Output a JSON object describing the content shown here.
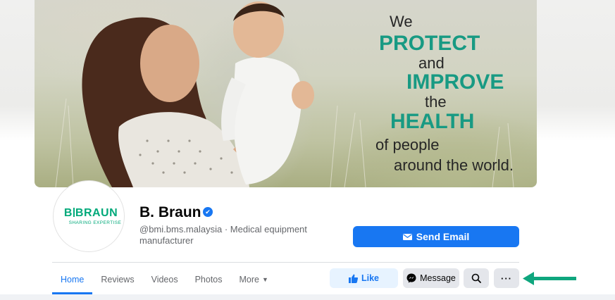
{
  "cover": {
    "tagline": [
      "We",
      "PROTECT",
      "and",
      "IMPROVE",
      "the",
      "HEALTH",
      "of people",
      "around the world."
    ],
    "accent_color": "#189a83"
  },
  "profile": {
    "logo_text": "B|BRAUN",
    "logo_subtext": "SHARING EXPERTISE",
    "name": "B. Braun",
    "verified_icon": "verified-check-icon",
    "handle_line": "@bmi.bms.malaysia · Medical equipment manufacturer"
  },
  "actions": {
    "send_email": "Send Email",
    "like": "Like",
    "message": "Message",
    "more": "···"
  },
  "tabs": [
    {
      "label": "Home",
      "active": true
    },
    {
      "label": "Reviews"
    },
    {
      "label": "Videos"
    },
    {
      "label": "Photos"
    },
    {
      "label": "More"
    }
  ],
  "colors": {
    "primary": "#1877f2",
    "annotation_arrow": "#0fa67e"
  }
}
